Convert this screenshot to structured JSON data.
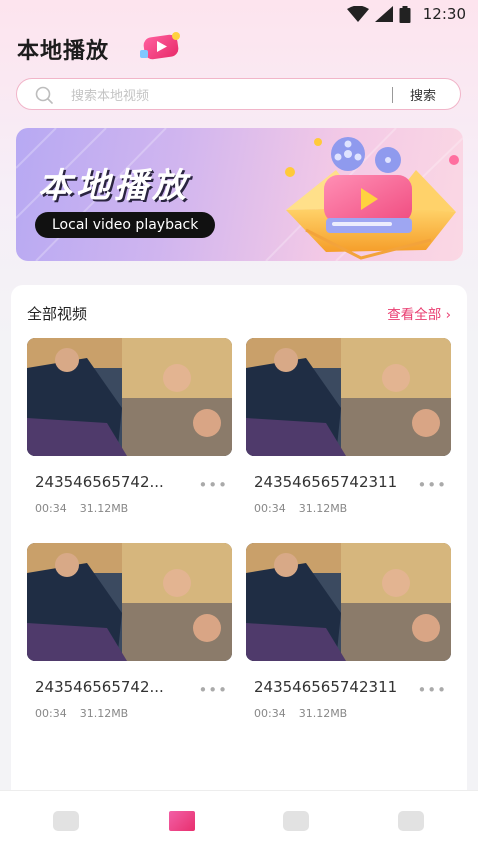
{
  "status": {
    "time": "12:30"
  },
  "header": {
    "title": "本地播放"
  },
  "search": {
    "placeholder": "搜索本地视频",
    "value": "",
    "button_label": "搜索"
  },
  "banner": {
    "title": "本地播放",
    "subtitle": "Local video playback"
  },
  "section": {
    "title": "全部视频",
    "view_all_label": "查看全部 ›"
  },
  "videos": [
    {
      "name": "243546565742...",
      "duration": "00:34",
      "size": "31.12MB"
    },
    {
      "name": "243546565742311",
      "duration": "00:34",
      "size": "31.12MB"
    },
    {
      "name": "243546565742...",
      "duration": "00:34",
      "size": "31.12MB"
    },
    {
      "name": "243546565742311",
      "duration": "00:34",
      "size": "31.12MB"
    }
  ],
  "more_icon_label": "•••",
  "colors": {
    "accent": "#e93b6f",
    "search_border": "#f1b5c9"
  }
}
